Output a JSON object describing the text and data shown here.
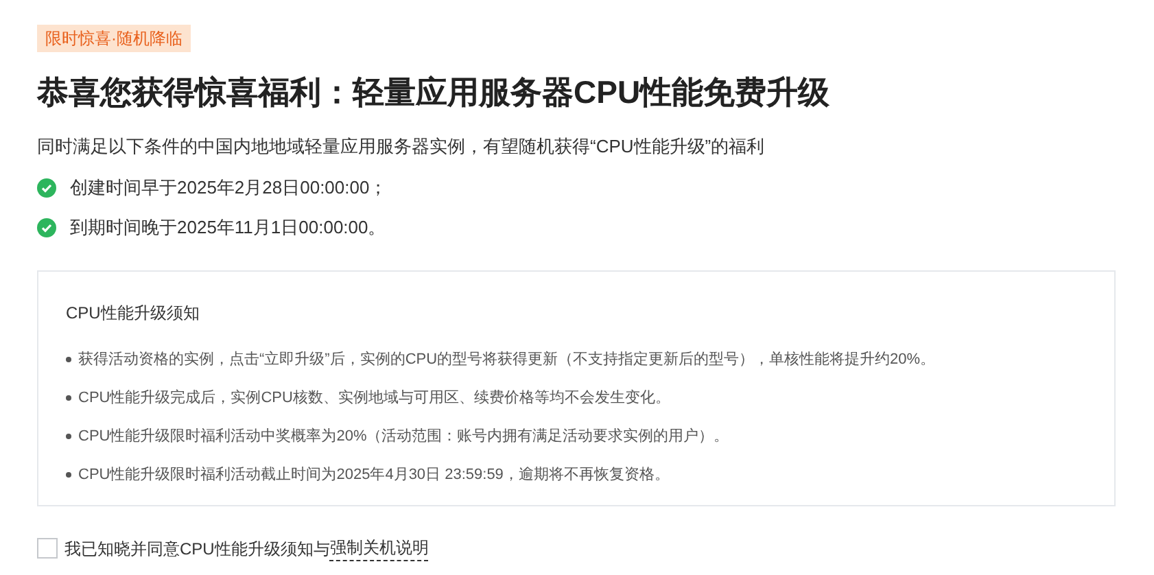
{
  "badge": "限时惊喜·随机降临",
  "title": "恭喜您获得惊喜福利：轻量应用服务器CPU性能免费升级",
  "intro": "同时满足以下条件的中国内地地域轻量应用服务器实例，有望随机获得“CPU性能升级”的福利",
  "conditions": [
    {
      "text": "创建时间早于2025年2月28日00:00:00；",
      "met": true
    },
    {
      "text": "到期时间晚于2025年11月1日00:00:00。",
      "met": true
    }
  ],
  "notice": {
    "title": "CPU性能升级须知",
    "items": [
      "获得活动资格的实例，点击“立即升级”后，实例的CPU的型号将获得更新（不支持指定更新后的型号），单核性能将提升约20%。",
      "CPU性能升级完成后，实例CPU核数、实例地域与可用区、续费价格等均不会发生变化。",
      "CPU性能升级限时福利活动中奖概率为20%（活动范围：账号内拥有满足活动要求实例的用户）。",
      "CPU性能升级限时福利活动截止时间为2025年4月30日 23:59:59，逾期将不再恢复资格。"
    ]
  },
  "agreement": {
    "text": "我已知晓并同意CPU性能升级须知与",
    "link": "强制关机说明",
    "checked": false
  }
}
